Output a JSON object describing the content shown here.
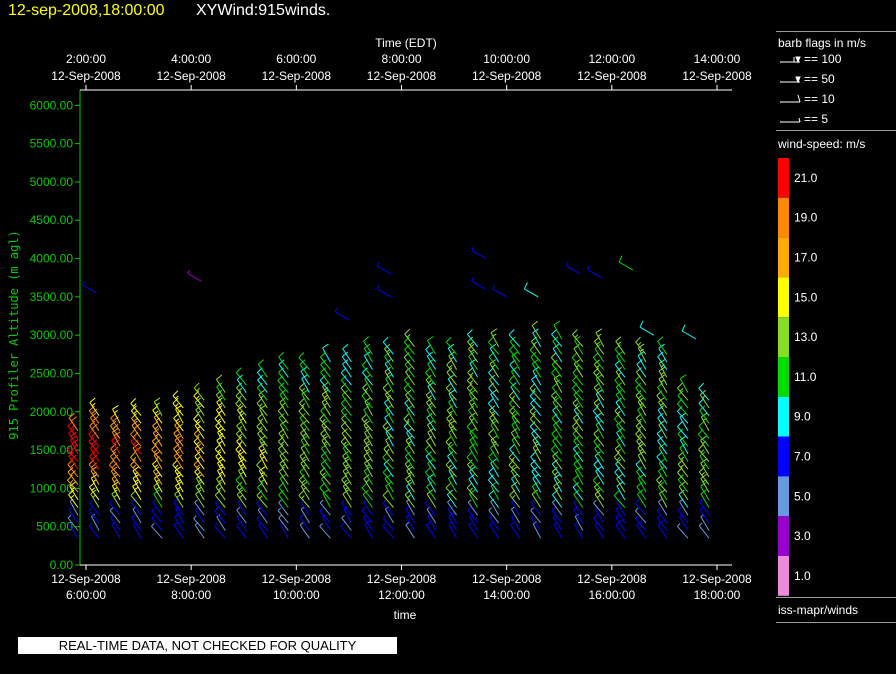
{
  "header": {
    "date_label": "12-sep-2008,18:00:00",
    "product_label": "XYWind:915winds."
  },
  "colors": {
    "background": "#000000",
    "title_date": "#ffff00",
    "left_axis": "#00cc00",
    "axis": "#ffffff"
  },
  "legend": {
    "barb_title": "barb flags in m/s",
    "barb_flags": [
      {
        "label": "== 100",
        "value": 100
      },
      {
        "label": "== 50",
        "value": 50
      },
      {
        "label": "== 10",
        "value": 10
      },
      {
        "label": "== 5",
        "value": 5
      }
    ],
    "speed_title": "wind-speed: m/s",
    "speed_scale": [
      {
        "label": "21.0",
        "color": "#ff0000"
      },
      {
        "label": "19.0",
        "color": "#ff8800"
      },
      {
        "label": "17.0",
        "color": "#ffaa00"
      },
      {
        "label": "15.0",
        "color": "#ffff00"
      },
      {
        "label": "13.0",
        "color": "#88dd22"
      },
      {
        "label": "11.0",
        "color": "#00dd00"
      },
      {
        "label": "9.0",
        "color": "#00ffff"
      },
      {
        "label": "7.0",
        "color": "#0000ff"
      },
      {
        "label": "5.0",
        "color": "#6699dd"
      },
      {
        "label": "3.0",
        "color": "#9900cc"
      },
      {
        "label": "1.0",
        "color": "#ee88dd"
      }
    ],
    "source_label": "iss-mapr/winds"
  },
  "footer": {
    "quality_notice": "REAL-TIME DATA, NOT CHECKED FOR QUALITY"
  },
  "chart_data": {
    "type": "scatter",
    "subtype": "wind-barbs",
    "top_axis_title": "Time (EDT)",
    "top_ticks": [
      {
        "time": "2:00:00",
        "date": "12-Sep-2008"
      },
      {
        "time": "4:00:00",
        "date": "12-Sep-2008"
      },
      {
        "time": "6:00:00",
        "date": "12-Sep-2008"
      },
      {
        "time": "8:00:00",
        "date": "12-Sep-2008"
      },
      {
        "time": "10:00:00",
        "date": "12-Sep-2008"
      },
      {
        "time": "12:00:00",
        "date": "12-Sep-2008"
      },
      {
        "time": "14:00:00",
        "date": "12-Sep-2008"
      }
    ],
    "bottom_axis_title": "time",
    "bottom_ticks": [
      {
        "time": "6:00:00",
        "date": "12-Sep-2008"
      },
      {
        "time": "8:00:00",
        "date": "12-Sep-2008"
      },
      {
        "time": "10:00:00",
        "date": "12-Sep-2008"
      },
      {
        "time": "12:00:00",
        "date": "12-Sep-2008"
      },
      {
        "time": "14:00:00",
        "date": "12-Sep-2008"
      },
      {
        "time": "16:00:00",
        "date": "12-Sep-2008"
      },
      {
        "time": "18:00:00",
        "date": "12-Sep-2008"
      }
    ],
    "ylabel": "915 Profiler Altitude (m agl)",
    "ylim": [
      0,
      6200
    ],
    "y_ticks": [
      "0.00",
      "500.00",
      "1000.00",
      "1500.00",
      "2000.00",
      "2500.00",
      "3000.00",
      "3500.00",
      "4000.00",
      "4500.00",
      "5000.00",
      "5500.00",
      "6000.00"
    ],
    "x_hours_utc_axis": [
      6,
      18
    ],
    "profile_times": [
      "06:00",
      "06:24",
      "06:48",
      "07:12",
      "07:36",
      "08:00",
      "08:24",
      "08:48",
      "09:12",
      "09:36",
      "10:00",
      "10:24",
      "10:48",
      "11:12",
      "11:36",
      "12:00",
      "12:24",
      "12:48",
      "13:12",
      "13:36",
      "14:00",
      "14:24",
      "14:48",
      "15:12",
      "15:36",
      "16:00",
      "16:24",
      "16:48",
      "17:12",
      "17:36",
      "18:00"
    ],
    "profile_tops_m": [
      1800,
      2000,
      1900,
      1950,
      2000,
      2100,
      2150,
      2300,
      2400,
      2450,
      2550,
      2600,
      2700,
      2700,
      2750,
      2800,
      2850,
      2800,
      2750,
      2850,
      2850,
      2900,
      2950,
      2950,
      2900,
      2850,
      2800,
      2800,
      2750,
      2300,
      2200
    ],
    "upper_barbs": [
      {
        "time": "06:12",
        "alt": 3550,
        "speed": 7
      },
      {
        "time": "08:12",
        "alt": 3700,
        "speed": 3
      },
      {
        "time": "11:00",
        "alt": 3200,
        "speed": 7
      },
      {
        "time": "11:48",
        "alt": 3500,
        "speed": 7
      },
      {
        "time": "11:48",
        "alt": 3800,
        "speed": 7
      },
      {
        "time": "13:36",
        "alt": 3600,
        "speed": 7
      },
      {
        "time": "13:36",
        "alt": 4000,
        "speed": 7
      },
      {
        "time": "14:00",
        "alt": 3500,
        "speed": 7
      },
      {
        "time": "14:36",
        "alt": 3500,
        "speed": 9
      },
      {
        "time": "15:24",
        "alt": 3800,
        "speed": 7
      },
      {
        "time": "15:48",
        "alt": 3750,
        "speed": 7
      },
      {
        "time": "16:24",
        "alt": 3850,
        "speed": 11
      },
      {
        "time": "16:48",
        "alt": 3000,
        "speed": 9
      },
      {
        "time": "17:36",
        "alt": 2950,
        "speed": 9
      }
    ]
  }
}
